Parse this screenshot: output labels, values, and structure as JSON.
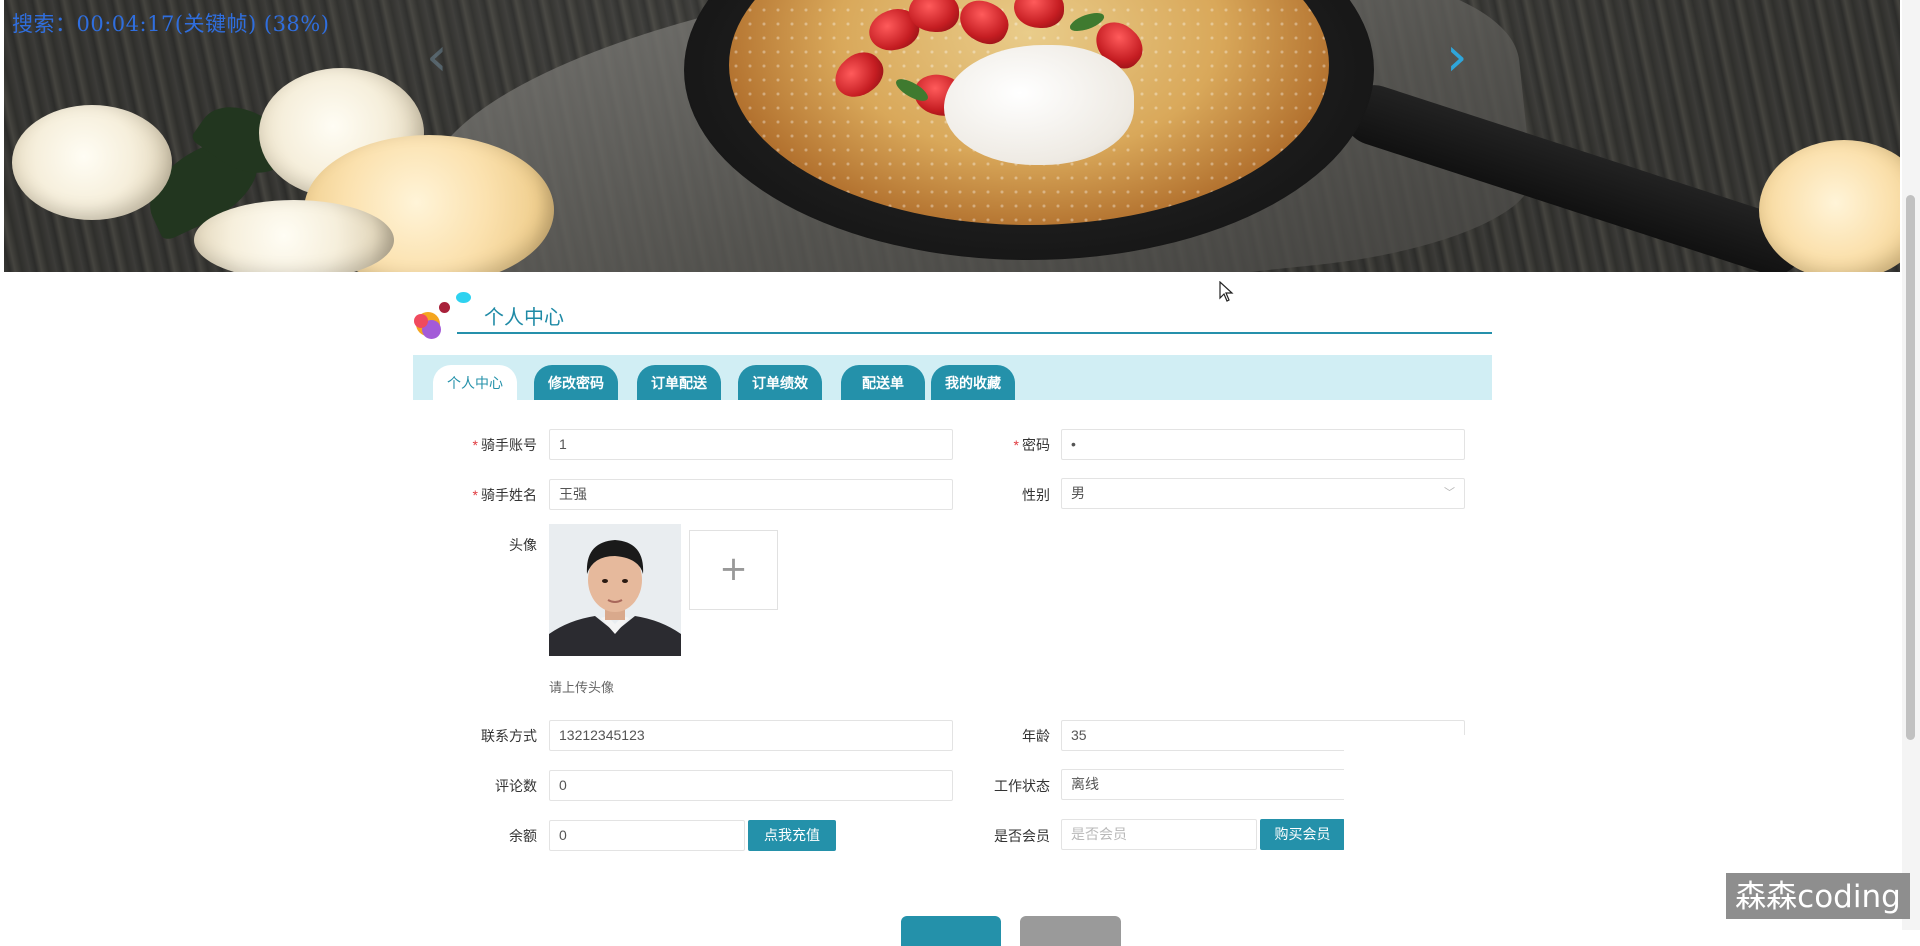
{
  "video_caption": "搜索：00:04:17(关键帧) (38%)",
  "banner": {
    "prev_icon": "chevron-left-icon",
    "next_icon": "chevron-right-icon"
  },
  "section_title": "个人中心",
  "tabs": [
    {
      "label": "个人中心",
      "active": true
    },
    {
      "label": "修改密码",
      "active": false
    },
    {
      "label": "订单配送",
      "active": false
    },
    {
      "label": "订单绩效",
      "active": false
    },
    {
      "label": "配送单",
      "active": false
    },
    {
      "label": "我的收藏",
      "active": false
    }
  ],
  "form": {
    "account": {
      "label": "骑手账号",
      "value": "1"
    },
    "password": {
      "label": "密码",
      "value": "•"
    },
    "name": {
      "label": "骑手姓名",
      "value": "王强"
    },
    "gender": {
      "label": "性别",
      "value": "男"
    },
    "avatar": {
      "label": "头像",
      "hint": "请上传头像",
      "upload_icon": "plus-icon"
    },
    "contact": {
      "label": "联系方式",
      "value": "13212345123"
    },
    "age": {
      "label": "年龄",
      "value": "35"
    },
    "comments": {
      "label": "评论数",
      "value": "0"
    },
    "work_status": {
      "label": "工作状态",
      "value": "离线"
    },
    "balance": {
      "label": "余额",
      "value": "0",
      "button": "点我充值"
    },
    "member": {
      "label": "是否会员",
      "placeholder": "是否会员",
      "button": "购买会员"
    }
  },
  "watermark": "森森coding",
  "colors": {
    "primary": "#2491aa",
    "tab_bar": "#d1eef4",
    "required": "#e0393e",
    "caption": "#2f6ede"
  }
}
